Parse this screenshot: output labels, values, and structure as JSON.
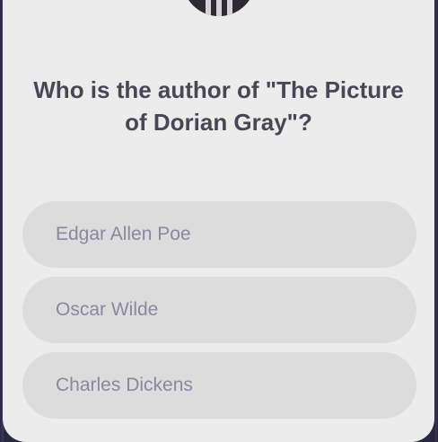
{
  "question": {
    "text": "Who is the author of \"The Picture of Dorian Gray\"?"
  },
  "options": [
    {
      "label": "Edgar Allen Poe"
    },
    {
      "label": "Oscar Wilde"
    },
    {
      "label": "Charles Dickens"
    }
  ],
  "colors": {
    "card_background": "#ececec",
    "option_background": "#dcdcdc",
    "question_text": "#4a4656",
    "option_text": "#8b87a0",
    "frame": "#2a2740"
  }
}
